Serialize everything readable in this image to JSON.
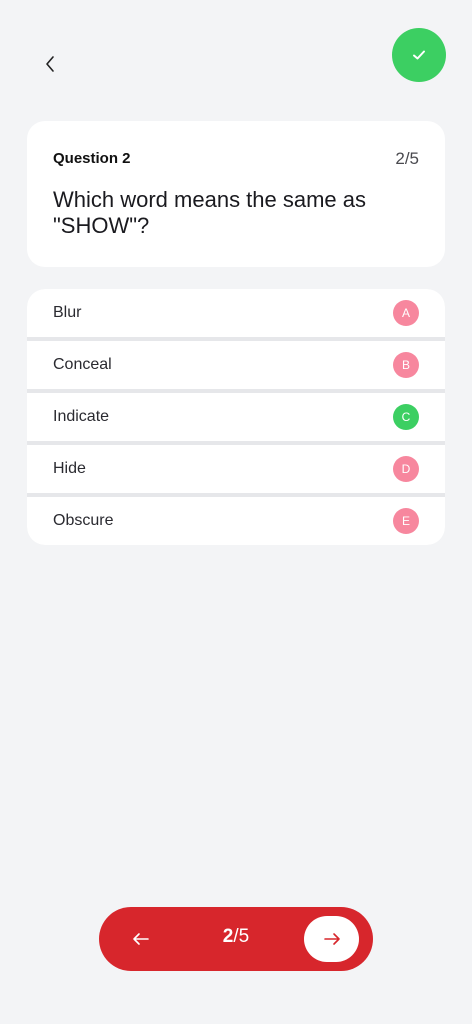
{
  "header": {
    "back_icon": "chevron-left-icon",
    "submit_icon": "checkmark-icon",
    "submit_color": "#3ccf62"
  },
  "question": {
    "label": "Question 2",
    "progress": "2/5",
    "text": "Which word means the same as \"SHOW\"?"
  },
  "answers": [
    {
      "text": "Blur",
      "letter": "A",
      "correct": false
    },
    {
      "text": "Conceal",
      "letter": "B",
      "correct": false
    },
    {
      "text": "Indicate",
      "letter": "C",
      "correct": true
    },
    {
      "text": "Hide",
      "letter": "D",
      "correct": false
    },
    {
      "text": "Obscure",
      "letter": "E",
      "correct": false
    }
  ],
  "footer": {
    "current": "2",
    "separator": "/",
    "total": "5",
    "prev_icon": "arrow-left-icon",
    "next_icon": "arrow-right-icon",
    "bar_color": "#d7262c"
  },
  "colors": {
    "background": "#f3f4f6",
    "correct": "#3ccf62",
    "incorrect_badge": "#f7879e",
    "accent": "#d7262c"
  }
}
